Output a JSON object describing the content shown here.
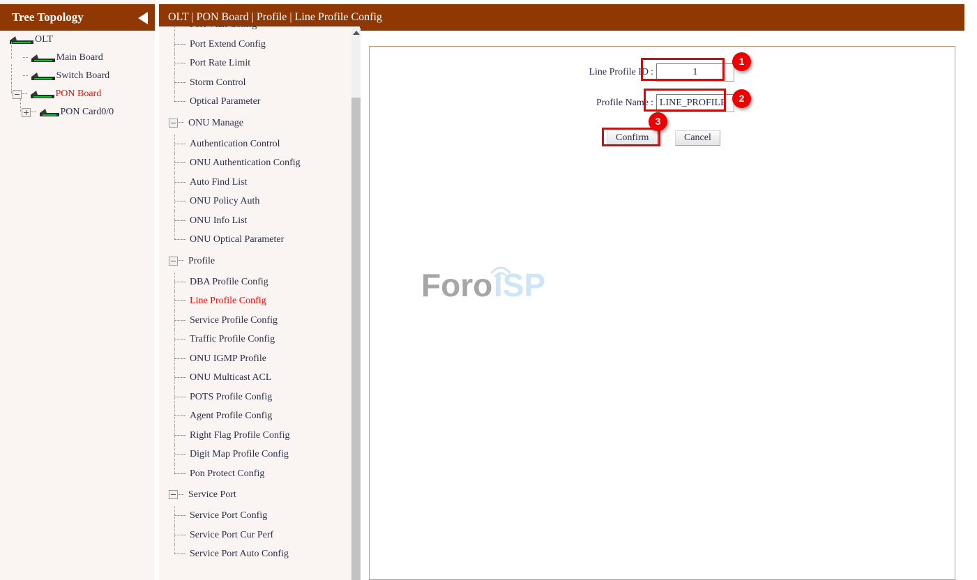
{
  "theme": {
    "header_bg": "#8f3803",
    "panel_bg": "#faf5f2",
    "content_bg": "#ffffff",
    "content_border": "#c09878",
    "accent_red": "#ff0000",
    "annotation_red": "#ee0000",
    "text": "#2c2f4a",
    "led_green": "#13c02b"
  },
  "tree_panel": {
    "title": "Tree Topology",
    "collapse_icon": "triangle-left-icon",
    "nodes": [
      {
        "label": "OLT",
        "depth": 0,
        "toggle": null,
        "icon": "device-olt-icon",
        "highlight": false
      },
      {
        "label": "Main Board",
        "depth": 1,
        "toggle": null,
        "icon": "device-board-icon",
        "highlight": false
      },
      {
        "label": "Switch Board",
        "depth": 1,
        "toggle": null,
        "icon": "device-board-icon",
        "highlight": false
      },
      {
        "label": "PON Board",
        "depth": 1,
        "toggle": "minus",
        "icon": "device-board-icon",
        "highlight": true
      },
      {
        "label": "PON Card0/0",
        "depth": 2,
        "toggle": "plus",
        "icon": "device-card-icon",
        "highlight": false
      }
    ]
  },
  "topbar": {
    "breadcrumb": "OLT | PON Board | Profile | Line Profile Config"
  },
  "nav": {
    "scrollbar": {
      "up_arrow_icon": "caret-up-icon"
    },
    "entries": [
      {
        "type": "item",
        "label": "Port Vlan Config",
        "active": false,
        "last": false,
        "clipped": true
      },
      {
        "type": "item",
        "label": "Port Extend Config",
        "active": false,
        "last": false
      },
      {
        "type": "item",
        "label": "Port Rate Limit",
        "active": false,
        "last": false
      },
      {
        "type": "item",
        "label": "Storm Control",
        "active": false,
        "last": false
      },
      {
        "type": "item",
        "label": "Optical Parameter",
        "active": false,
        "last": true
      },
      {
        "type": "group",
        "label": "ONU Manage",
        "toggle": "minus"
      },
      {
        "type": "item",
        "label": "Authentication Control",
        "active": false,
        "last": false
      },
      {
        "type": "item",
        "label": "ONU Authentication Config",
        "active": false,
        "last": false
      },
      {
        "type": "item",
        "label": "Auto Find List",
        "active": false,
        "last": false
      },
      {
        "type": "item",
        "label": "ONU Policy Auth",
        "active": false,
        "last": false
      },
      {
        "type": "item",
        "label": "ONU Info List",
        "active": false,
        "last": false
      },
      {
        "type": "item",
        "label": "ONU Optical Parameter",
        "active": false,
        "last": true
      },
      {
        "type": "group",
        "label": "Profile",
        "toggle": "minus"
      },
      {
        "type": "item",
        "label": "DBA Profile Config",
        "active": false,
        "last": false
      },
      {
        "type": "item",
        "label": "Line Profile Config",
        "active": true,
        "last": false
      },
      {
        "type": "item",
        "label": "Service Profile Config",
        "active": false,
        "last": false
      },
      {
        "type": "item",
        "label": "Traffic Profile Config",
        "active": false,
        "last": false
      },
      {
        "type": "item",
        "label": "ONU IGMP Profile",
        "active": false,
        "last": false
      },
      {
        "type": "item",
        "label": "ONU Multicast ACL",
        "active": false,
        "last": false
      },
      {
        "type": "item",
        "label": "POTS Profile Config",
        "active": false,
        "last": false
      },
      {
        "type": "item",
        "label": "Agent Profile Config",
        "active": false,
        "last": false
      },
      {
        "type": "item",
        "label": "Right Flag Profile Config",
        "active": false,
        "last": false
      },
      {
        "type": "item",
        "label": "Digit Map Profile Config",
        "active": false,
        "last": false
      },
      {
        "type": "item",
        "label": "Pon Protect Config",
        "active": false,
        "last": true
      },
      {
        "type": "group",
        "label": "Service Port",
        "toggle": "minus"
      },
      {
        "type": "item",
        "label": "Service Port Config",
        "active": false,
        "last": false
      },
      {
        "type": "item",
        "label": "Service Port Cur Perf",
        "active": false,
        "last": false
      },
      {
        "type": "item",
        "label": "Service Port Auto Config",
        "active": false,
        "last": true
      }
    ]
  },
  "form": {
    "fields": [
      {
        "label": "Line Profile ID",
        "colon": ":",
        "value": "1",
        "placeholder": ""
      },
      {
        "label": "Profile Name",
        "colon": ":",
        "value": "LINE_PROFILE",
        "placeholder": ""
      }
    ],
    "buttons": {
      "confirm": "Confirm",
      "cancel": "Cancel"
    }
  },
  "watermark": {
    "text_left": "Foro",
    "text_right": "ISP",
    "icon": "wifi-signal-icon",
    "color_left": "#a6a6a6",
    "color_right": "#cfe4f5"
  },
  "annotations": [
    {
      "number": "1",
      "target": "line-profile-id-input"
    },
    {
      "number": "2",
      "target": "profile-name-input"
    },
    {
      "number": "3",
      "target": "confirm-button"
    }
  ]
}
